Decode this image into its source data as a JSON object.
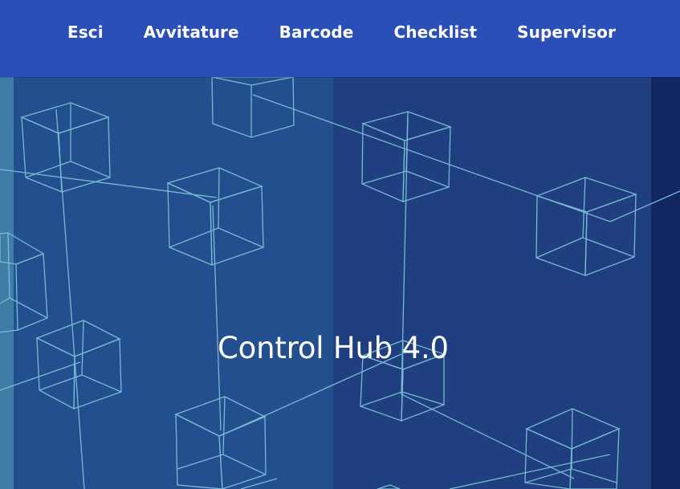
{
  "nav": {
    "items": [
      {
        "label": "Esci"
      },
      {
        "label": "Avvitature"
      },
      {
        "label": "Barcode"
      },
      {
        "label": "Checklist"
      },
      {
        "label": "Supervisor"
      }
    ]
  },
  "hero": {
    "title": "Control Hub 4.0",
    "background_graphic": "wireframe-cube-network"
  },
  "colors": {
    "nav_bg": "#2a4fb6",
    "hero_bg": "#1e3c7d",
    "line_color": "#7ac1d6",
    "text": "#ffffff"
  }
}
